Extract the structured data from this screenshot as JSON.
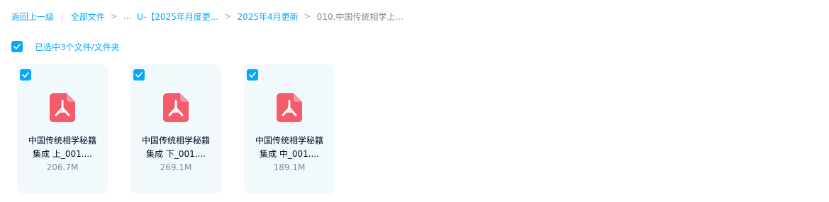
{
  "breadcrumb": {
    "back": "返回上一级",
    "separator_bar": "|",
    "all_files": "全部文件",
    "sep": ">",
    "ellipsis": "...",
    "folder1": "U-【2025年月度更...",
    "folder2": "2025年4月更新",
    "current": "010.中国传统相学上..."
  },
  "selection": {
    "label": "已选中3个文件/文件夹",
    "checked": true
  },
  "files": [
    {
      "name_line1": "中国传统相学秘籍",
      "name_line2": "集成 上_001....",
      "size": "206.7M",
      "icon": "pdf-icon",
      "checked": true
    },
    {
      "name_line1": "中国传统相学秘籍",
      "name_line2": "集成 下_001....",
      "size": "269.1M",
      "icon": "pdf-icon",
      "checked": true
    },
    {
      "name_line1": "中国传统相学秘籍",
      "name_line2": "集成 中_001....",
      "size": "189.1M",
      "icon": "pdf-icon",
      "checked": true
    }
  ],
  "colors": {
    "accent": "#06a7ff",
    "card_bg": "#f2f9fd",
    "pdf_red": "#f45c6b",
    "text_primary": "#03081a",
    "text_secondary": "#818999"
  }
}
